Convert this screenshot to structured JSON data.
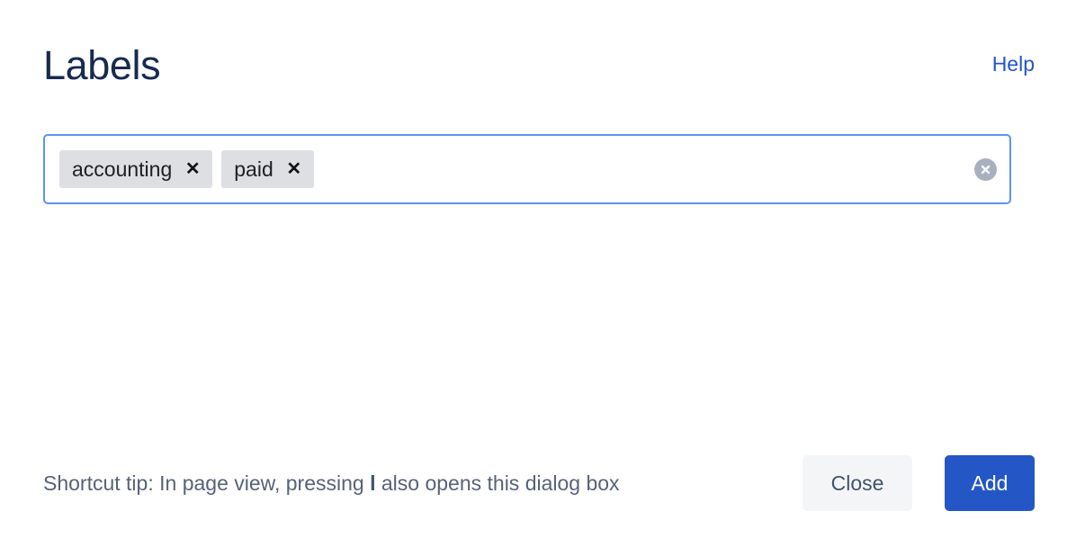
{
  "dialog": {
    "title": "Labels",
    "help_link": "Help"
  },
  "labels_field": {
    "placeholder": "",
    "input_value": "",
    "clear_icon": "clear-circle-x-icon",
    "chips": [
      {
        "label": "accounting",
        "remove_icon": "close-x-icon",
        "remove_glyph": "✕"
      },
      {
        "label": "paid",
        "remove_icon": "close-x-icon",
        "remove_glyph": "✕"
      }
    ]
  },
  "footer": {
    "tip_prefix": "Shortcut tip: In page view, pressing ",
    "tip_key": "l",
    "tip_suffix": " also opens this dialog box",
    "close_label": "Close",
    "add_label": "Add"
  },
  "colors": {
    "title": "#182a4e",
    "link": "#2555c8",
    "field_border_focus": "#5b94f0",
    "chip_background": "#dedfe3",
    "clear_icon": "#a9b0bd",
    "tip_text": "#576278",
    "close_background": "#f4f5f7",
    "close_text": "#42526e",
    "add_background": "#2456c6",
    "add_text": "#ffffff"
  }
}
